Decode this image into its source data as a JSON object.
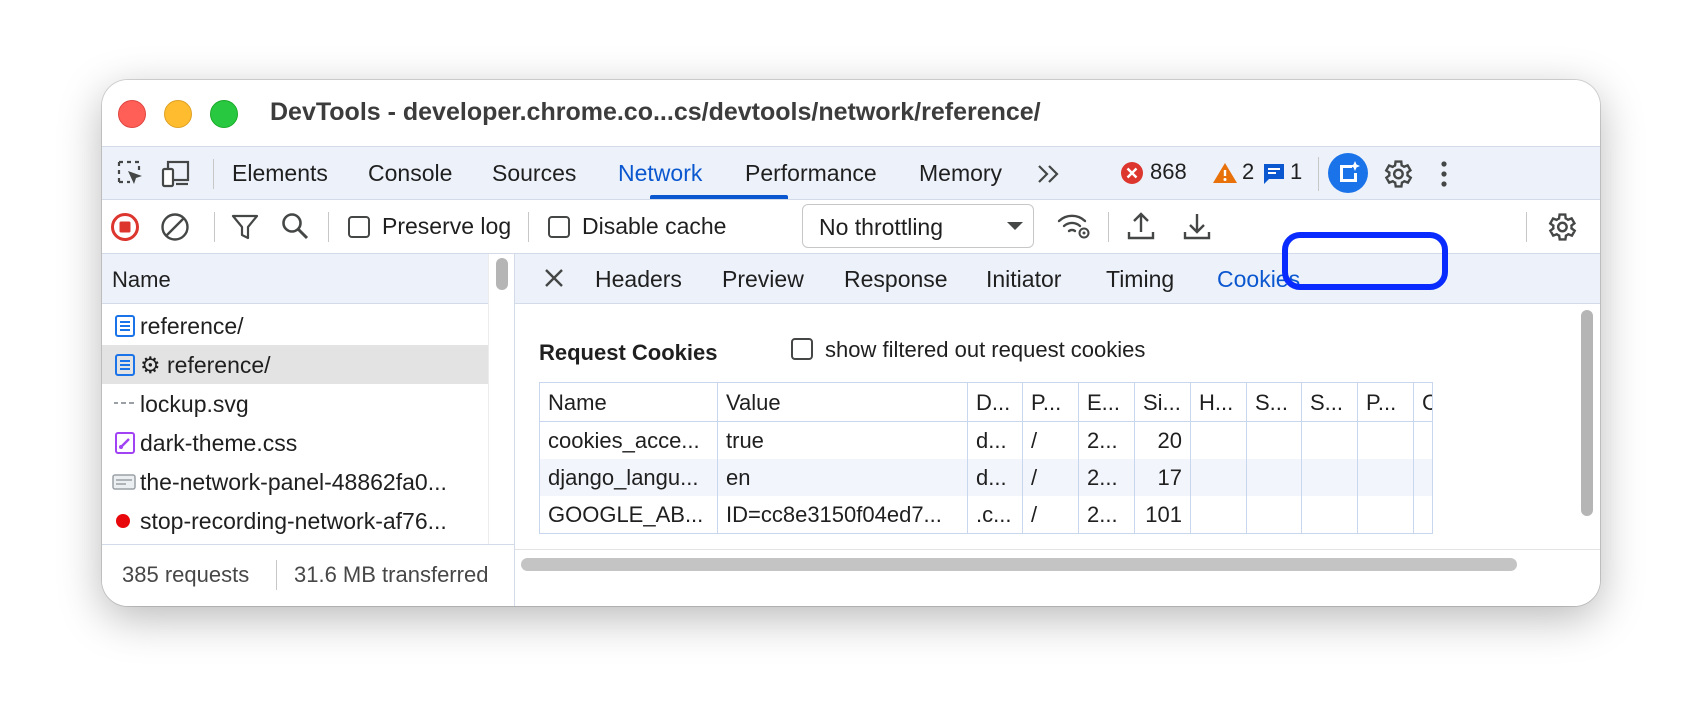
{
  "window": {
    "title": "DevTools - developer.chrome.co...cs/devtools/network/reference/"
  },
  "tabs": [
    "Elements",
    "Console",
    "Sources",
    "Network",
    "Performance",
    "Memory"
  ],
  "badges": {
    "errors": "868",
    "warnings": "2",
    "messages": "1"
  },
  "toolbar": {
    "preserve_log": "Preserve log",
    "disable_cache": "Disable cache",
    "throttling": "No throttling"
  },
  "requests": {
    "header": "Name",
    "items": [
      {
        "label": "reference/",
        "icon": "document-icon"
      },
      {
        "label": "⚙ reference/",
        "icon": "document-icon"
      },
      {
        "label": "lockup.svg",
        "icon": "image-icon"
      },
      {
        "label": "dark-theme.css",
        "icon": "stylesheet-icon"
      },
      {
        "label": "the-network-panel-48862fa0...",
        "icon": "image-icon"
      },
      {
        "label": "stop-recording-network-af76...",
        "icon": "red-dot-icon"
      }
    ]
  },
  "status": {
    "requests": "385 requests",
    "transferred": "31.6 MB transferred"
  },
  "detail_tabs": [
    "Headers",
    "Preview",
    "Response",
    "Initiator",
    "Timing",
    "Cookies"
  ],
  "cookies": {
    "section_title": "Request Cookies",
    "filter_label": "show filtered out request cookies",
    "columns": [
      "Name",
      "Value",
      "D...",
      "P...",
      "E...",
      "Si...",
      "H...",
      "S...",
      "S...",
      "P...",
      "C"
    ],
    "rows": [
      [
        "cookies_acce...",
        "true",
        "d...",
        "/",
        "2...",
        "20"
      ],
      [
        "django_langu...",
        "en",
        "d...",
        "/",
        "2...",
        "17"
      ],
      [
        "GOOGLE_AB...",
        "ID=cc8e3150f04ed7...",
        ".c...",
        "/",
        "2...",
        "101"
      ]
    ]
  },
  "colors": {
    "accent": "#0b57d0",
    "highlight": "#0a2bff",
    "error": "#dc362e",
    "warning": "#e8710a"
  }
}
